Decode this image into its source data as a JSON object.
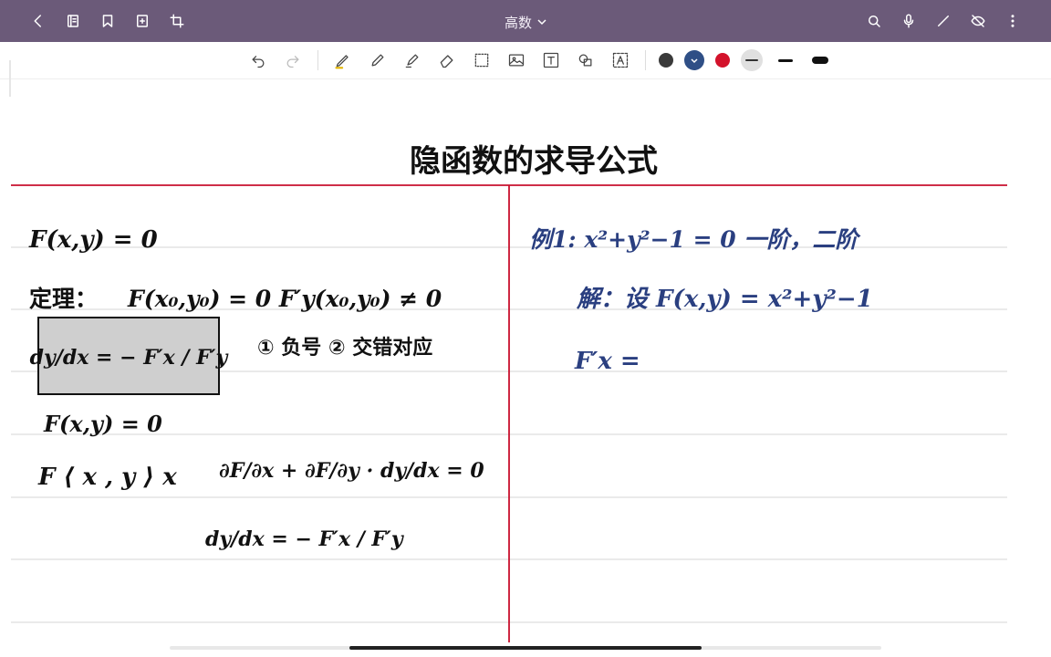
{
  "app": {
    "title": "高数",
    "accent": "#6b5a79"
  },
  "topbar": {
    "left_icons": [
      "back-icon",
      "pages-icon",
      "bookmark-icon",
      "add-page-icon",
      "crop-icon"
    ],
    "right_icons": [
      "search-icon",
      "mic-icon",
      "pen-mode-icon",
      "hide-icon",
      "more-icon"
    ]
  },
  "toolbar": {
    "tools": [
      "undo-icon",
      "redo-icon",
      "pen-icon",
      "fountain-pen-icon",
      "highlighter-icon",
      "eraser-icon",
      "lasso-select-icon",
      "image-icon",
      "text-icon",
      "shape-icon",
      "text-recognize-icon"
    ],
    "colors": [
      "#3a3a3a",
      "#2f4f86",
      "#d3122b"
    ],
    "selected_color": "#2f4f86"
  },
  "note": {
    "title": "隐函数的求导公式",
    "left": {
      "line1": "F(x,y) = 0",
      "theorem_label": "定理：",
      "theorem": "F(x₀,y₀) = 0   F′y(x₀,y₀) ≠ 0",
      "box_formula": "dy/dx = − F′x / F′y",
      "notes": "① 负号   ② 交错对应",
      "line4": "F(x,y) = 0",
      "chain": "F ⟨ x , y ⟩ x",
      "partial": "∂F/∂x + ∂F/∂y · dy/dx = 0",
      "result": "dy/dx = − F′x / F′y"
    },
    "right": {
      "example": "例1: x²+y²−1 = 0    一阶，二阶",
      "solution": "解：设 F(x,y) = x²+y²−1",
      "fx": "F′x ="
    },
    "ink_color_left": "#111111",
    "ink_color_right": "#2a3f80"
  }
}
